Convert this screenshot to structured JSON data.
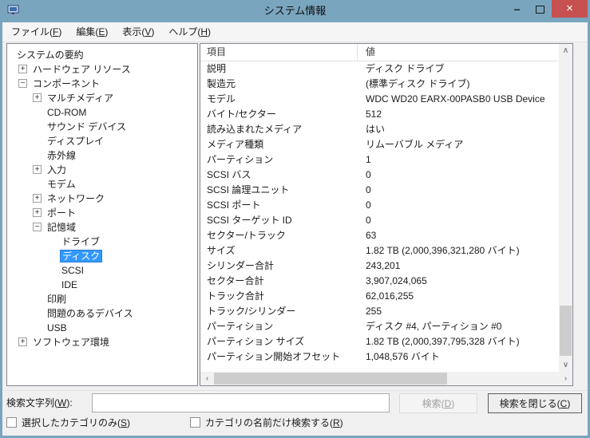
{
  "window": {
    "title": "システム情報"
  },
  "icons": {
    "app": "computer-monitor",
    "minimize": "–",
    "maximize": "square-outline",
    "close": "×",
    "scroll_up": "∧",
    "scroll_down": "∨",
    "scroll_left": "‹",
    "scroll_right": "›",
    "expander_closed": "+",
    "expander_open": "−"
  },
  "colors": {
    "titlebar": "#79a5bf",
    "window_border": "#79a5bf",
    "close_button": "#c75050",
    "selection": "#3399ff",
    "panel_border": "#828790",
    "disabled_text": "#a0a0a0"
  },
  "menu": {
    "items": [
      {
        "name": "file",
        "label": "ファイル(F)"
      },
      {
        "name": "edit",
        "label": "編集(E)"
      },
      {
        "name": "view",
        "label": "表示(V)"
      },
      {
        "name": "help",
        "label": "ヘルプ(H)"
      }
    ]
  },
  "tree": {
    "items": [
      {
        "name": "system-summary",
        "label": "システムの要約",
        "level": 0,
        "expander": null,
        "selected": false
      },
      {
        "name": "hardware-resources",
        "label": "ハードウェア リソース",
        "level": 1,
        "expander": "plus",
        "selected": false
      },
      {
        "name": "components",
        "label": "コンポーネント",
        "level": 1,
        "expander": "minus",
        "selected": false
      },
      {
        "name": "multimedia",
        "label": "マルチメディア",
        "level": 2,
        "expander": "plus",
        "selected": false
      },
      {
        "name": "cd-rom",
        "label": "CD-ROM",
        "level": 2,
        "expander": null,
        "selected": false
      },
      {
        "name": "sound-devices",
        "label": "サウンド デバイス",
        "level": 2,
        "expander": null,
        "selected": false
      },
      {
        "name": "display",
        "label": "ディスプレイ",
        "level": 2,
        "expander": null,
        "selected": false
      },
      {
        "name": "infrared",
        "label": "赤外線",
        "level": 2,
        "expander": null,
        "selected": false
      },
      {
        "name": "input",
        "label": "入力",
        "level": 2,
        "expander": "plus",
        "selected": false
      },
      {
        "name": "modem",
        "label": "モデム",
        "level": 2,
        "expander": null,
        "selected": false
      },
      {
        "name": "network",
        "label": "ネットワーク",
        "level": 2,
        "expander": "plus",
        "selected": false
      },
      {
        "name": "ports",
        "label": "ポート",
        "level": 2,
        "expander": "plus",
        "selected": false
      },
      {
        "name": "storage",
        "label": "記憶域",
        "level": 2,
        "expander": "minus",
        "selected": false
      },
      {
        "name": "drives",
        "label": "ドライブ",
        "level": 3,
        "expander": null,
        "selected": false
      },
      {
        "name": "disks",
        "label": "ディスク",
        "level": 3,
        "expander": null,
        "selected": true
      },
      {
        "name": "scsi",
        "label": "SCSI",
        "level": 3,
        "expander": null,
        "selected": false
      },
      {
        "name": "ide",
        "label": "IDE",
        "level": 3,
        "expander": null,
        "selected": false
      },
      {
        "name": "printing",
        "label": "印刷",
        "level": 2,
        "expander": null,
        "selected": false
      },
      {
        "name": "problem-devices",
        "label": "問題のあるデバイス",
        "level": 2,
        "expander": null,
        "selected": false
      },
      {
        "name": "usb",
        "label": "USB",
        "level": 2,
        "expander": null,
        "selected": false
      },
      {
        "name": "software-environment",
        "label": "ソフトウェア環境",
        "level": 1,
        "expander": "plus",
        "selected": false
      }
    ]
  },
  "details": {
    "columns": [
      "項目",
      "値"
    ],
    "rows": [
      [
        "説明",
        "ディスク ドライブ"
      ],
      [
        "製造元",
        "(標準ディスク ドライブ)"
      ],
      [
        "モデル",
        "WDC WD20 EARX-00PASB0 USB Device"
      ],
      [
        "バイト/セクター",
        "512"
      ],
      [
        "読み込まれたメディア",
        "はい"
      ],
      [
        "メディア種類",
        "リムーバブル メディア"
      ],
      [
        "パーティション",
        "1"
      ],
      [
        "SCSI バス",
        "0"
      ],
      [
        "SCSI 論理ユニット",
        "0"
      ],
      [
        "SCSI ポート",
        "0"
      ],
      [
        "SCSI ターゲット ID",
        "0"
      ],
      [
        "セクター/トラック",
        "63"
      ],
      [
        "サイズ",
        "1.82 TB (2,000,396,321,280 バイト)"
      ],
      [
        "シリンダー合計",
        "243,201"
      ],
      [
        "セクター合計",
        "3,907,024,065"
      ],
      [
        "トラック合計",
        "62,016,255"
      ],
      [
        "トラック/シリンダー",
        "255"
      ],
      [
        "パーティション",
        "ディスク #4, パーティション #0"
      ],
      [
        "パーティション サイズ",
        "1.82 TB (2,000,397,795,328 バイト)"
      ],
      [
        "パーティション開始オフセット",
        "1,048,576 バイト"
      ]
    ]
  },
  "search": {
    "label": "検索文字列(W):",
    "input_value": "",
    "search_button": "検索(D)",
    "search_button_disabled": true,
    "close_search_button": "検索を閉じる(C)",
    "checkbox_selected_category": {
      "label": "選択したカテゴリのみ(S)",
      "checked": false
    },
    "checkbox_category_names_only": {
      "label": "カテゴリの名前だけ検索する(R)",
      "checked": false
    }
  }
}
